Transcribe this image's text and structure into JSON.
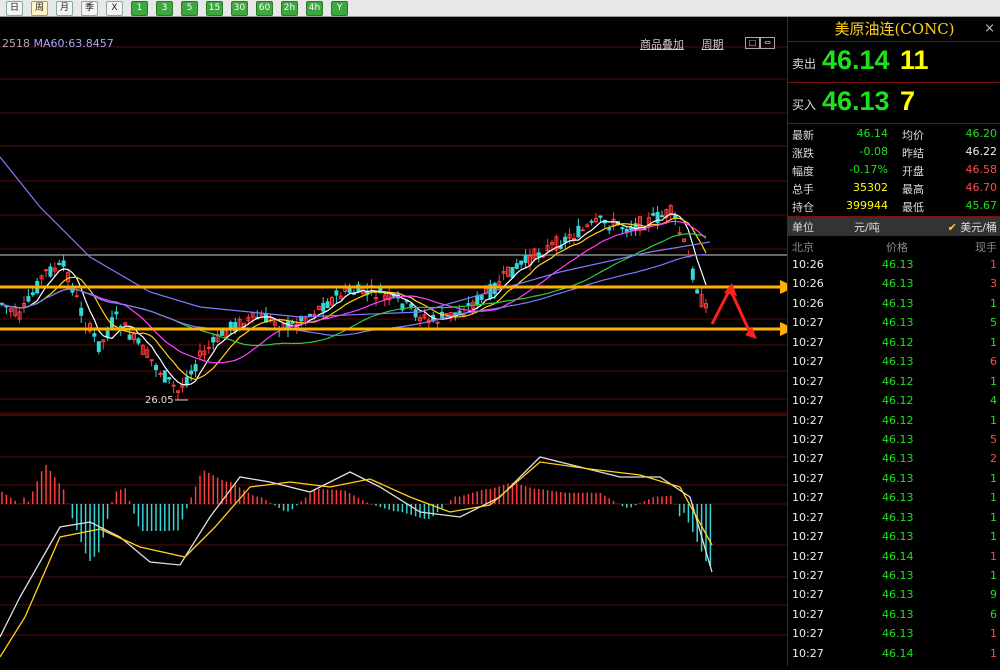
{
  "toolbar": {
    "buttons": [
      {
        "label": "日",
        "style": "plain"
      },
      {
        "label": "周",
        "style": "sel"
      },
      {
        "label": "月",
        "style": "plain"
      },
      {
        "label": "季",
        "style": "plain"
      },
      {
        "label": "X",
        "style": "plain"
      },
      {
        "label": "1",
        "style": "g"
      },
      {
        "label": "3",
        "style": "g"
      },
      {
        "label": "5",
        "style": "g"
      },
      {
        "label": "15",
        "style": "g"
      },
      {
        "label": "30",
        "style": "g"
      },
      {
        "label": "60",
        "style": "g"
      },
      {
        "label": "2h",
        "style": "g"
      },
      {
        "label": "4h",
        "style": "g"
      },
      {
        "label": "Y",
        "style": "g"
      }
    ]
  },
  "chart": {
    "ma_legend_prefix": "2518",
    "ma60": "MA60:63.8457",
    "tool_overlay": "商品叠加",
    "tool_period": "周期",
    "low_label": "26.05"
  },
  "quote": {
    "title": "美原油连(CONC)",
    "sell_label": "卖出",
    "sell_price": "46.14",
    "sell_vol": "11",
    "buy_label": "买入",
    "buy_price": "46.13",
    "buy_vol": "7"
  },
  "stats": [
    {
      "l1": "最新",
      "v1": "46.14",
      "c1": "green",
      "l2": "均价",
      "v2": "46.20",
      "c2": "green"
    },
    {
      "l1": "涨跌",
      "v1": "-0.08",
      "c1": "green",
      "l2": "昨结",
      "v2": "46.22",
      "c2": "white"
    },
    {
      "l1": "幅度",
      "v1": "-0.17%",
      "c1": "green",
      "l2": "开盘",
      "v2": "46.58",
      "c2": "red"
    },
    {
      "l1": "总手",
      "v1": "35302",
      "c1": "yellow",
      "l2": "最高",
      "v2": "46.70",
      "c2": "red"
    },
    {
      "l1": "持仓",
      "v1": "399944",
      "c1": "yellow",
      "l2": "最低",
      "v2": "45.67",
      "c2": "green"
    }
  ],
  "unit": {
    "label": "单位",
    "value": "元/吨",
    "alt": "美元/桶"
  },
  "ticks_head": {
    "time": "北京",
    "price": "价格",
    "vol": "现手"
  },
  "ticks": [
    {
      "time": "10:26",
      "price": "46.13",
      "vol": "1",
      "vc": "red"
    },
    {
      "time": "10:26",
      "price": "46.13",
      "vol": "3",
      "vc": "red"
    },
    {
      "time": "10:26",
      "price": "46.13",
      "vol": "1",
      "vc": "green"
    },
    {
      "time": "10:27",
      "price": "46.13",
      "vol": "5",
      "vc": "green"
    },
    {
      "time": "10:27",
      "price": "46.12",
      "vol": "1",
      "vc": "green"
    },
    {
      "time": "10:27",
      "price": "46.13",
      "vol": "6",
      "vc": "red"
    },
    {
      "time": "10:27",
      "price": "46.12",
      "vol": "1",
      "vc": "green"
    },
    {
      "time": "10:27",
      "price": "46.12",
      "vol": "4",
      "vc": "green"
    },
    {
      "time": "10:27",
      "price": "46.12",
      "vol": "1",
      "vc": "green"
    },
    {
      "time": "10:27",
      "price": "46.13",
      "vol": "5",
      "vc": "red"
    },
    {
      "time": "10:27",
      "price": "46.13",
      "vol": "2",
      "vc": "red"
    },
    {
      "time": "10:27",
      "price": "46.13",
      "vol": "1",
      "vc": "green"
    },
    {
      "time": "10:27",
      "price": "46.13",
      "vol": "1",
      "vc": "green"
    },
    {
      "time": "10:27",
      "price": "46.13",
      "vol": "1",
      "vc": "green"
    },
    {
      "time": "10:27",
      "price": "46.13",
      "vol": "1",
      "vc": "green"
    },
    {
      "time": "10:27",
      "price": "46.14",
      "vol": "1",
      "vc": "red"
    },
    {
      "time": "10:27",
      "price": "46.13",
      "vol": "1",
      "vc": "green"
    },
    {
      "time": "10:27",
      "price": "46.13",
      "vol": "9",
      "vc": "green"
    },
    {
      "time": "10:27",
      "price": "46.13",
      "vol": "6",
      "vc": "green"
    },
    {
      "time": "10:27",
      "price": "46.13",
      "vol": "1",
      "vc": "red"
    },
    {
      "time": "10:27",
      "price": "46.14",
      "vol": "1",
      "vc": "red"
    }
  ],
  "colors": {
    "up": "#ff3b3b",
    "down": "#34d6d6",
    "ma_fast": "#ffffff",
    "ma_mid": "#ffd21a",
    "ma_slow": "#ff40ff",
    "ma_long": "#7b7bff",
    "green": "#1fe01f",
    "accent_line": "#ffb000"
  }
}
